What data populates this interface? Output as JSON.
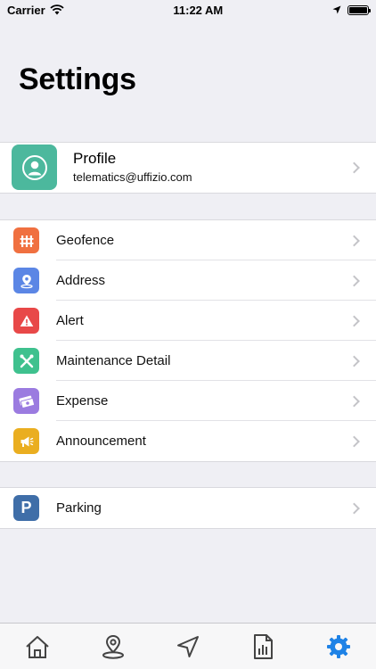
{
  "status_bar": {
    "carrier": "Carrier",
    "time": "11:22 AM"
  },
  "page": {
    "title": "Settings"
  },
  "profile": {
    "name": "Profile",
    "email": "telematics@uffizio.com",
    "color": "#4cb89d"
  },
  "menu": [
    {
      "label": "Geofence",
      "icon": "fence-icon",
      "color": "#f07040"
    },
    {
      "label": "Address",
      "icon": "map-pin-icon",
      "color": "#5b86e5"
    },
    {
      "label": "Alert",
      "icon": "warning-icon",
      "color": "#e84848"
    },
    {
      "label": "Maintenance Detail",
      "icon": "tools-icon",
      "color": "#3fc18e"
    },
    {
      "label": "Expense",
      "icon": "money-icon",
      "color": "#9b7be0"
    },
    {
      "label": "Announcement",
      "icon": "megaphone-icon",
      "color": "#eaae20"
    }
  ],
  "parking": {
    "label": "Parking",
    "icon_letter": "P",
    "icon": "parking-icon",
    "color": "#3f6ea8"
  },
  "tab_bar": {
    "tabs": [
      "home-tab",
      "location-tab",
      "navigation-tab",
      "reports-tab",
      "settings-tab"
    ],
    "active_color": "#1e82e6"
  }
}
